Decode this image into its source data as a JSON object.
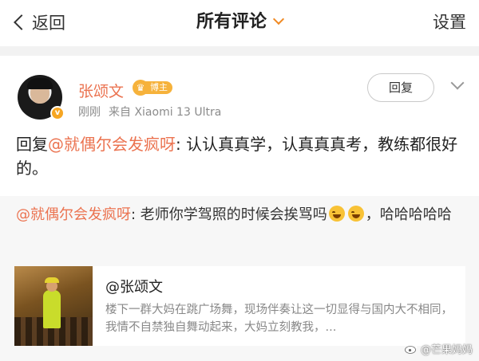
{
  "header": {
    "back_label": "返回",
    "title": "所有评论",
    "settings_label": "设置"
  },
  "comment": {
    "author": "张颂文",
    "vip_tag": "博主",
    "avatar_badge": "v",
    "time": "刚刚",
    "source": "来自 Xiaomi 13 Ultra",
    "reply_button": "回复",
    "body_prefix": "回复",
    "body_mention": "@就偶尔会发疯呀",
    "body_text": ": 认认真真学，认真真真考，教练都很好的。"
  },
  "quoted": {
    "mention": "@就偶尔会发疯呀",
    "text_before": ": 老师你学驾照的时候会挨骂吗",
    "emoji_1": "laugh-cry-emoji",
    "emoji_2": "laugh-cry-emoji",
    "text_after": "，哈哈哈哈哈",
    "card": {
      "title": "@张颂文",
      "desc": "楼下一群大妈在跳广场舞，现场伴奏让这一切显得与国内大不相同，我情不自禁独自舞动起来，大妈立刻教我，..."
    }
  },
  "watermark": "@芒果妈妈",
  "colors": {
    "accent": "#eb7350",
    "vip": "#f6b23b",
    "chevron": "#f08a24"
  }
}
